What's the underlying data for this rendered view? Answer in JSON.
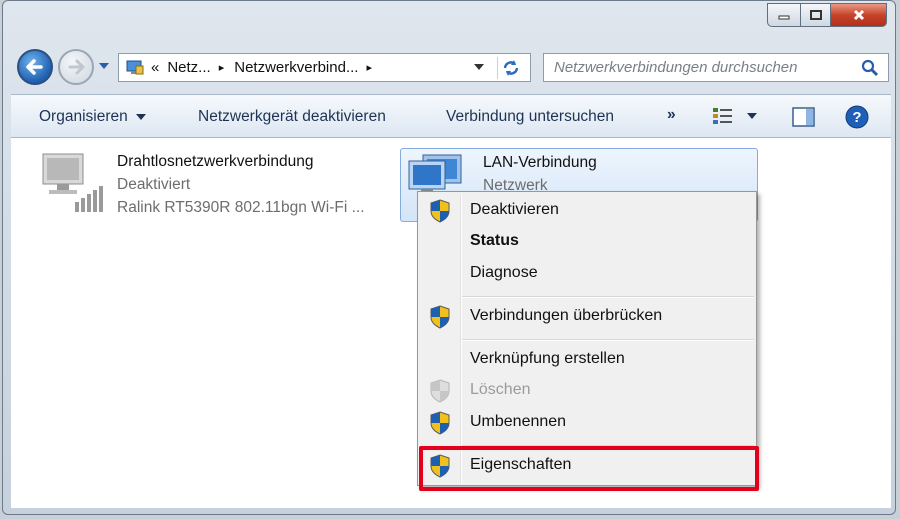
{
  "window": {
    "controls": {
      "minimize_icon": "minimize-icon",
      "maximize_icon": "maximize-icon",
      "close_icon": "close-icon"
    }
  },
  "address_bar": {
    "overflow": "«",
    "segments": [
      "Netz...",
      "Netzwerkverbind..."
    ],
    "separator": "▸"
  },
  "search": {
    "placeholder": "Netzwerkverbindungen durchsuchen"
  },
  "toolbar": {
    "organize": "Organisieren",
    "disable_device": "Netzwerkgerät deaktivieren",
    "diagnose": "Verbindung untersuchen",
    "more": "»"
  },
  "connections": [
    {
      "name": "Drahtlosnetzwerkverbindung",
      "status": "Deaktiviert",
      "device": "Ralink RT5390R 802.11bgn Wi-Fi ..."
    },
    {
      "name": "LAN-Verbindung",
      "status": "Netzwerk"
    }
  ],
  "context_menu": {
    "items": [
      {
        "label": "Deaktivieren",
        "shield": true
      },
      {
        "label": "Status",
        "bold": true
      },
      {
        "label": "Diagnose"
      },
      {
        "label": "Verbindungen überbrücken",
        "shield": true
      },
      {
        "label": "Verknüpfung erstellen"
      },
      {
        "label": "Löschen",
        "shield": true,
        "disabled": true
      },
      {
        "label": "Umbenennen",
        "shield": true
      },
      {
        "label": "Eigenschaften",
        "shield": true,
        "highlighted": true
      }
    ]
  },
  "colors": {
    "highlight_box": "#e3001b",
    "selection": "#d3e5f8",
    "shield_blue": "#1f5faf",
    "shield_yellow": "#f2c01a"
  }
}
